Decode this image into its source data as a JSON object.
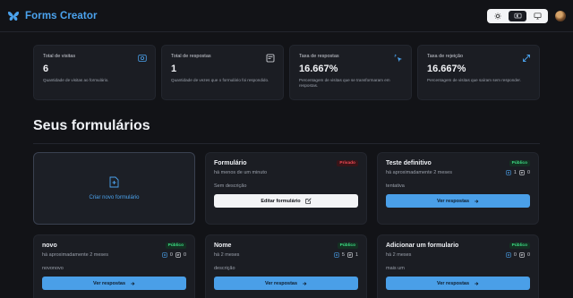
{
  "header": {
    "brand": "Forms Creator",
    "theme_modes": [
      "light",
      "system",
      "dark"
    ],
    "active_theme": "system"
  },
  "stats": [
    {
      "title": "Total de visitas",
      "value": "6",
      "help": "Quantidade de visitas ao formulário.",
      "icon": "eye-icon"
    },
    {
      "title": "Total de respostas",
      "value": "1",
      "help": "Quantidade de vezes que o formulário foi respondido.",
      "icon": "form-icon"
    },
    {
      "title": "Taxa de respostas",
      "value": "16.667%",
      "help": "Percentagem de visitas que se transformaram em respostas.",
      "icon": "cursor-click-icon"
    },
    {
      "title": "Taxa de rejeição",
      "value": "16.667%",
      "help": "Percentagem de visitas que saíram sem responder.",
      "icon": "arrows-out-icon"
    }
  ],
  "section_title": "Seus formulários",
  "new_form_label": "Criar novo formulário",
  "forms": [
    {
      "title": "Formulário",
      "badge": "Privado",
      "published": false,
      "date": "há menos de um minuto",
      "description": "Sem descrição",
      "action": "Editar formulário"
    },
    {
      "title": "Teste definitivo",
      "badge": "Público",
      "published": true,
      "date": "há aproximadamente 2 meses",
      "visits": "1",
      "responses": "0",
      "description": "tentativa",
      "action": "Ver respostas"
    },
    {
      "title": "novo",
      "badge": "Público",
      "published": true,
      "date": "há aproximadamente 2 meses",
      "visits": "0",
      "responses": "0",
      "description": "novonovo",
      "action": "Ver respostas"
    },
    {
      "title": "Nome",
      "badge": "Público",
      "published": true,
      "date": "há 2 meses",
      "visits": "5",
      "responses": "1",
      "description": "descrição",
      "action": "Ver respostas"
    },
    {
      "title": "Adicionar um formulario",
      "badge": "Público",
      "published": true,
      "date": "há 2 meses",
      "visits": "0",
      "responses": "0",
      "description": "mais um",
      "action": "Ver respostas"
    }
  ],
  "colors": {
    "accent": "#4a9fe8",
    "brand": "#4ba3ee",
    "public": "#3ddc84",
    "private": "#ef4a55",
    "background": "#121317",
    "card": "#1b1d23"
  }
}
